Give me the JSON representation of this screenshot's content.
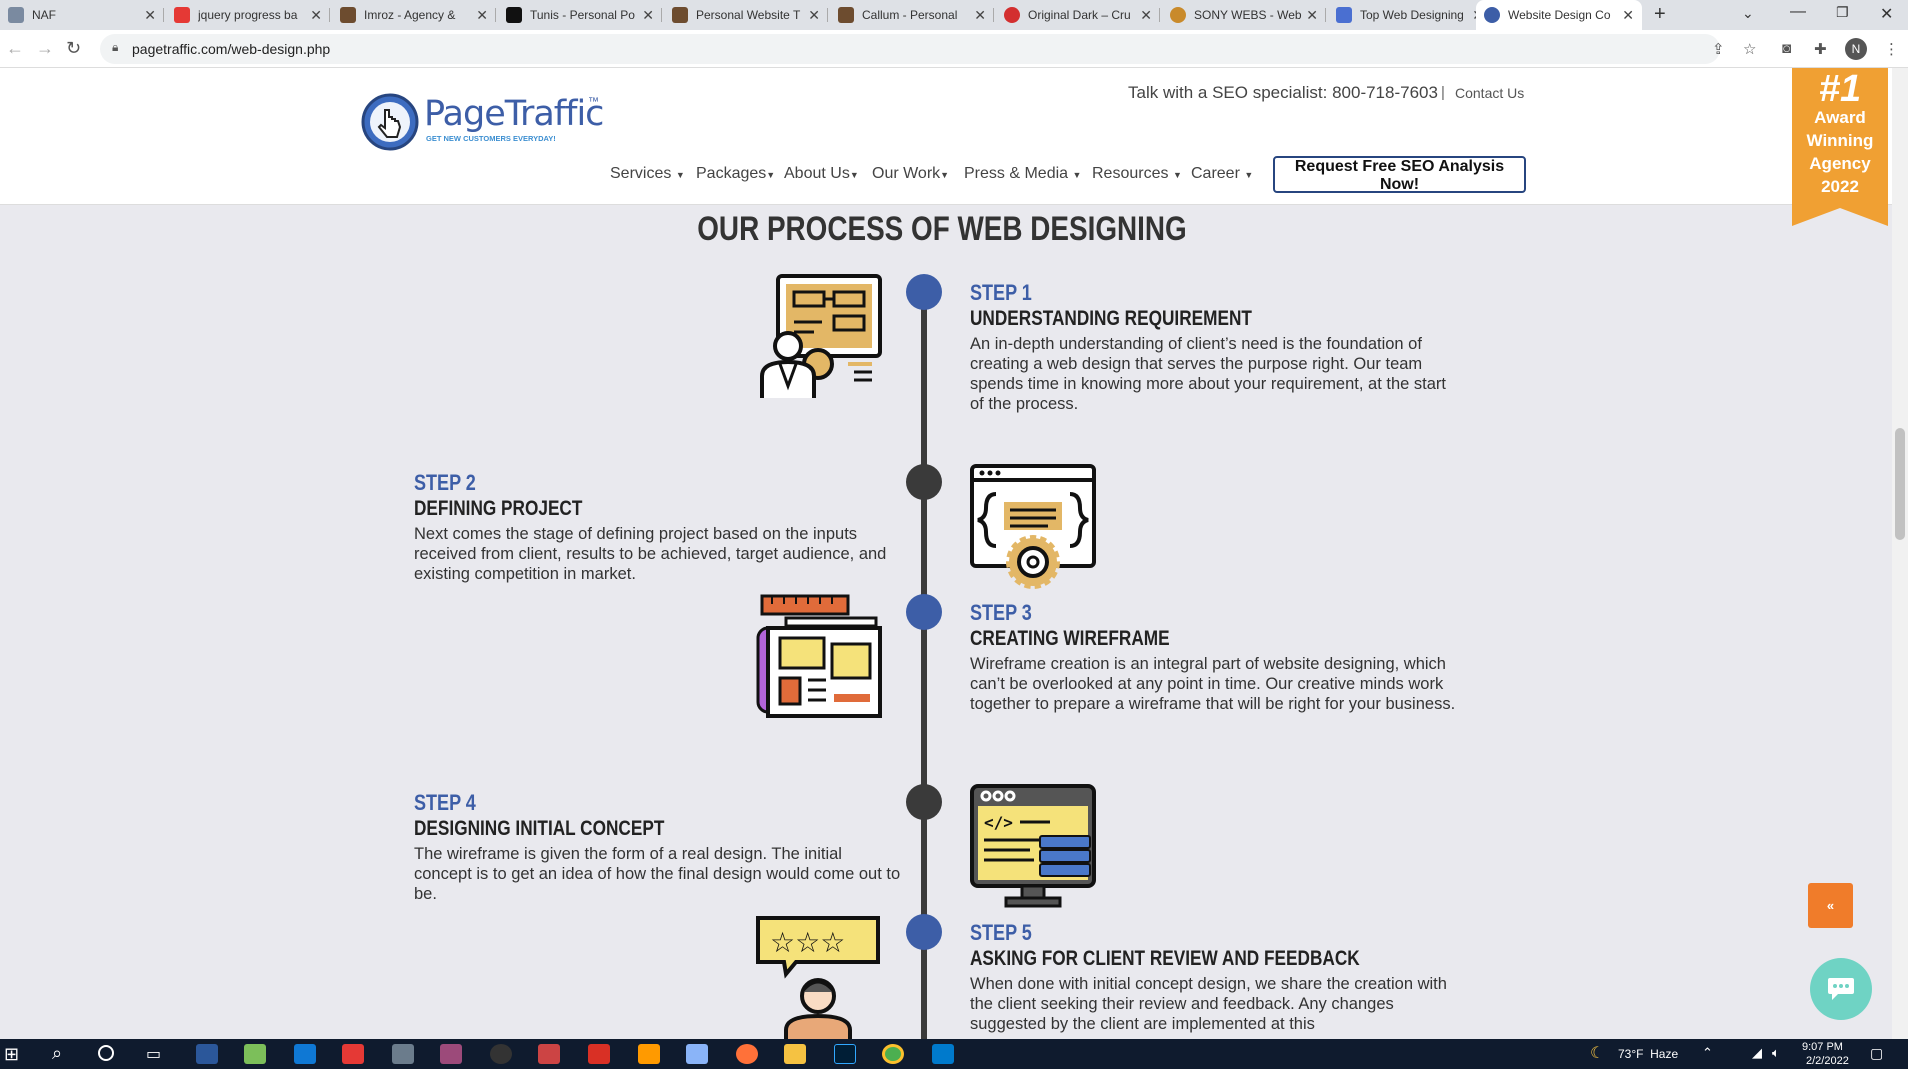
{
  "browser": {
    "tabs": [
      {
        "title": "NAF",
        "color": "#7a8aa0"
      },
      {
        "title": "jquery progress ba",
        "color": "#e53935"
      },
      {
        "title": "Imroz - Agency &",
        "color": "#6d4c2f"
      },
      {
        "title": "Tunis - Personal Po",
        "color": "#111111"
      },
      {
        "title": "Personal Website T",
        "color": "#6d4c2f"
      },
      {
        "title": "Callum - Personal",
        "color": "#6d4c2f"
      },
      {
        "title": "Original Dark – Cru",
        "color": "#d32f2f"
      },
      {
        "title": "SONY WEBS - Web",
        "color": "#c98a2b"
      },
      {
        "title": "Top Web Designing",
        "color": "#4a6fd1"
      },
      {
        "title": "Website Design Co",
        "color": "#3d5ea7"
      }
    ],
    "url": "pagetraffic.com/web-design.php",
    "profile_initial": "N"
  },
  "header": {
    "logo_text": "PageTraffic",
    "logo_tm": "™",
    "logo_tagline": "GET NEW CUSTOMERS EVERYDAY!",
    "phone_label": "Talk with a SEO specialist: 800-718-7603",
    "separator": "|",
    "contact": "Contact Us",
    "nav": [
      "Services",
      "Packages",
      "About Us",
      "Our Work",
      "Press & Media",
      "Resources",
      "Career"
    ],
    "cta": "Request Free SEO Analysis Now!"
  },
  "badge": {
    "rank": "#1",
    "line1": "Award",
    "line2": "Winning",
    "line3": "Agency",
    "year": "2022"
  },
  "section": {
    "heading": "OUR PROCESS OF WEB DESIGNING",
    "steps": [
      {
        "num": "STEP 1",
        "title": "UNDERSTANDING REQUIREMENT",
        "desc": "An in-depth understanding of client’s need is the foundation of creating a web design that serves the purpose right. Our team spends time in knowing more about your requirement, at the start of the process."
      },
      {
        "num": "STEP 2",
        "title": "DEFINING PROJECT",
        "desc": "Next comes the stage of defining project based on the inputs received from client, results to be achieved, target audience, and existing competition in market."
      },
      {
        "num": "STEP 3",
        "title": "CREATING WIREFRAME",
        "desc": "Wireframe creation is an integral part of website designing, which can’t be overlooked at any point in time. Our creative minds work together to prepare a wireframe that will be right for your business."
      },
      {
        "num": "STEP 4",
        "title": "DESIGNING INITIAL CONCEPT",
        "desc": "The wireframe is given the form of a real design. The initial concept is to get an idea of how the final design would come out to be."
      },
      {
        "num": "STEP 5",
        "title": "ASKING FOR CLIENT REVIEW AND FEEDBACK",
        "desc": "When done with initial concept design, we share the creation with the client seeking their review and feedback. Any changes suggested by the client are implemented at this"
      }
    ]
  },
  "colors": {
    "accent": "#3d5ea7",
    "dark_dot": "#3a3a3a",
    "badge": "#f0a033",
    "scroll_top": "#f07c2a",
    "chat": "#6fd3c4"
  },
  "taskbar": {
    "weather": "73°F  Haze",
    "time": "9:07 PM",
    "date": "2/2/2022"
  }
}
